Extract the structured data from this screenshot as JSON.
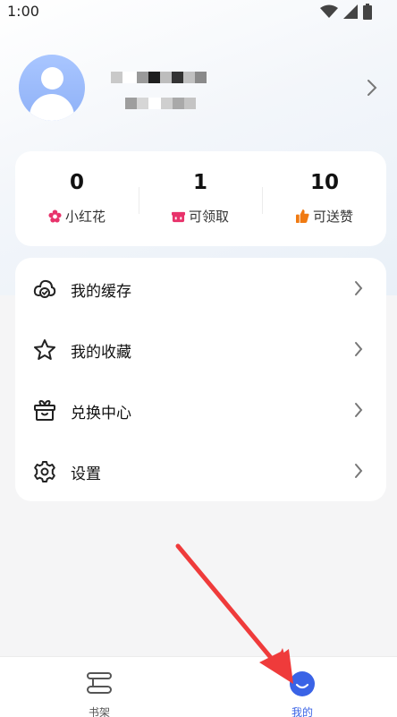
{
  "status_bar": {
    "time": "1:00"
  },
  "stats": [
    {
      "value": "0",
      "label": "小红花",
      "icon": "flower-icon",
      "color": "#e8336b"
    },
    {
      "value": "1",
      "label": "可领取",
      "icon": "gift-icon",
      "color": "#e8336b"
    },
    {
      "value": "10",
      "label": "可送赞",
      "icon": "thumbs-up-icon",
      "color": "#f07a12"
    }
  ],
  "menu": [
    {
      "label": "我的缓存",
      "icon": "cache-icon"
    },
    {
      "label": "我的收藏",
      "icon": "star-icon"
    },
    {
      "label": "兑换中心",
      "icon": "gift-box-icon"
    },
    {
      "label": "设置",
      "icon": "gear-icon"
    }
  ],
  "bottom_nav": [
    {
      "label": "书架",
      "icon": "bookshelf-icon",
      "active": false
    },
    {
      "label": "我的",
      "icon": "smile-icon",
      "active": true
    }
  ],
  "colors": {
    "accent": "#3a63e6",
    "arrow": "#ef3b3b"
  }
}
